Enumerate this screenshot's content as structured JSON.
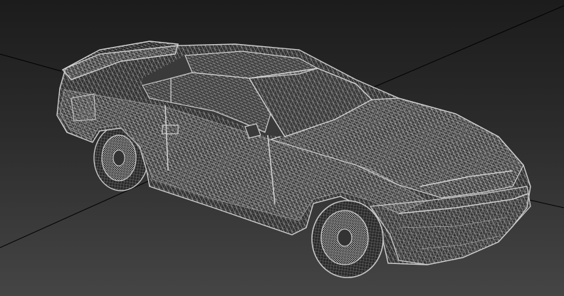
{
  "viewport": {
    "background_top": "#1c1c1c",
    "background_bottom": "#454545",
    "grid_line_color": "#000000",
    "wire_color": "#bdbdbd"
  },
  "model": {
    "subject": "sports-car",
    "render_mode": "wireframe"
  }
}
